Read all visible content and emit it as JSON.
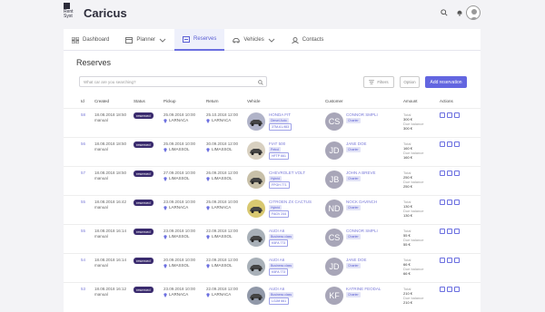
{
  "header": {
    "logo_line1": "Rent",
    "logo_line2": "Syst",
    "app_title": "Caricus"
  },
  "nav": {
    "tabs": [
      {
        "label": "Dashboard"
      },
      {
        "label": "Planner"
      },
      {
        "label": "Reserves"
      },
      {
        "label": "Vehicles"
      },
      {
        "label": "Contacts"
      }
    ]
  },
  "page": {
    "title": "Reserves",
    "search_placeholder": "What car are you searching?",
    "filters_label": "Filters",
    "option_label": "Option",
    "add_label": "Add reservation"
  },
  "table": {
    "headers": [
      "Id",
      "Created",
      "Status",
      "Pickup",
      "Return",
      "Vehicle",
      "Customer",
      "Amount",
      "Actions"
    ],
    "rows": [
      {
        "id": "58",
        "created": "18.08.2018 18:50",
        "created_by": "manual",
        "status": "reserved",
        "pickup_date": "25.09.2018 10:00",
        "pickup_loc": "LARNACA",
        "return_date": "25.10.2018 12:00",
        "return_loc": "LARNACA",
        "vehicle": "HONDA FIT",
        "vehicle_tag": "Diesel Auto",
        "plate": "3TM-61-983",
        "initials": "CS",
        "customer": "CONNOR SMPLI",
        "cust_tag": "Charter",
        "total": "300 €",
        "due": "300 €"
      },
      {
        "id": "56",
        "created": "18.08.2018 18:50",
        "created_by": "manual",
        "status": "reserved",
        "pickup_date": "25.09.2018 10:00",
        "pickup_loc": "LIMASSOL",
        "return_date": "30.09.2018 12:00",
        "return_loc": "LIMASSOL",
        "vehicle": "FIAT 500",
        "vehicle_tag": "Petrol",
        "plate": "HFTP 661",
        "initials": "JD",
        "customer": "JANE DOE",
        "cust_tag": "Charter",
        "total": "160 €",
        "due": "160 €"
      },
      {
        "id": "57",
        "created": "18.08.2018 18:50",
        "created_by": "manual",
        "status": "reserved",
        "pickup_date": "27.09.2018 10:00",
        "pickup_loc": "LIMASSOL",
        "return_date": "26.09.2018 12:00",
        "return_loc": "LIMASSOL",
        "vehicle": "CHEVROLET VOLT",
        "vehicle_tag": "Hybrid",
        "plate": "FPGH 771",
        "initials": "JB",
        "customer": "JOHN A BREVE",
        "cust_tag": "Charter",
        "total": "250 €",
        "due": "250 €"
      },
      {
        "id": "55",
        "created": "18.08.2018 16:42",
        "created_by": "manual",
        "status": "reserved",
        "pickup_date": "23.09.2018 10:00",
        "pickup_loc": "LARNACA",
        "return_date": "25.09.2018 10:00",
        "return_loc": "LARNACA",
        "vehicle": "CITROEN ZX CACTUS",
        "vehicle_tag": "Hybrid",
        "plate": "FAGV 244",
        "initials": "ND",
        "customer": "NOCK DAVINCH",
        "cust_tag": "Charter",
        "total": "130 €",
        "due": "130 €"
      },
      {
        "id": "55",
        "created": "18.08.2018 16:14",
        "created_by": "manual",
        "status": "reserved",
        "pickup_date": "23.09.2018 10:00",
        "pickup_loc": "LIMASSOL",
        "return_date": "22.09.2018 12:00",
        "return_loc": "LIMASSOL",
        "vehicle": "AUDI A6",
        "vehicle_tag": "Business class",
        "plate": "K5FA 773",
        "initials": "CS",
        "customer": "CONNOR SMPLI",
        "cust_tag": "Charter",
        "total": "55 €",
        "due": "55 €"
      },
      {
        "id": "54",
        "created": "18.08.2018 16:14",
        "created_by": "manual",
        "status": "reserved",
        "pickup_date": "20.09.2018 10:00",
        "pickup_loc": "LIMASSOL",
        "return_date": "22.09.2018 12:00",
        "return_loc": "LIMASSOL",
        "vehicle": "AUDI A6",
        "vehicle_tag": "Business class",
        "plate": "K5FA 773",
        "initials": "JD",
        "customer": "JANE DOE",
        "cust_tag": "Charter",
        "total": "66 €",
        "due": "66 €"
      },
      {
        "id": "53",
        "created": "18.08.2018 16:12",
        "created_by": "manual",
        "status": "reserved",
        "pickup_date": "23.09.2018 10:00",
        "pickup_loc": "LARNACA",
        "return_date": "22.09.2018 12:00",
        "return_loc": "LARNACA",
        "vehicle": "AUDI A6",
        "vehicle_tag": "Business class",
        "plate": "LGJM 661",
        "initials": "KF",
        "customer": "KATRINE FEODAL",
        "cust_tag": "Charter",
        "total": "210 €",
        "due": "210 €"
      }
    ],
    "total_label": "Total",
    "due_label": "Due balance"
  }
}
